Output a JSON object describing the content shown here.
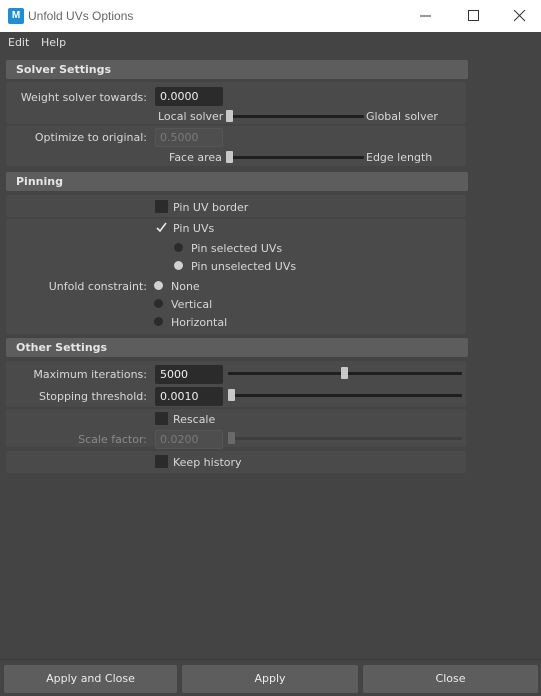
{
  "window": {
    "title": "Unfold UVs Options",
    "app_icon_letter": "M"
  },
  "menu": {
    "edit": "Edit",
    "help": "Help"
  },
  "solver": {
    "header": "Solver Settings",
    "weight_label": "Weight solver towards:",
    "weight_value": "0.0000",
    "weight_left": "Local solver",
    "weight_right": "Global solver",
    "weight_slider": 0.0,
    "optimize_label": "Optimize to original:",
    "optimize_value": "0.5000",
    "optimize_left": "Face area",
    "optimize_right": "Edge length",
    "optimize_slider": 0.0
  },
  "pinning": {
    "header": "Pinning",
    "pin_border": "Pin UV border",
    "pin_border_checked": false,
    "pin_uvs": "Pin UVs",
    "pin_uvs_checked": true,
    "pin_selected": "Pin selected UVs",
    "pin_unselected": "Pin unselected UVs",
    "pin_mode_selected": "Pin unselected UVs",
    "constraint_label": "Unfold constraint:",
    "constraint_none": "None",
    "constraint_vertical": "Vertical",
    "constraint_horizontal": "Horizontal",
    "constraint_selected": "None"
  },
  "other": {
    "header": "Other Settings",
    "max_iter_label": "Maximum iterations:",
    "max_iter_value": "5000",
    "max_iter_slider": 0.5,
    "stop_label": "Stopping threshold:",
    "stop_value": "0.0010",
    "stop_slider": 0.0,
    "rescale": "Rescale",
    "rescale_checked": false,
    "scale_label": "Scale factor:",
    "scale_value": "0.0200",
    "scale_slider": 0.0,
    "keep_history": "Keep history",
    "keep_history_checked": false
  },
  "footer": {
    "apply_close": "Apply and Close",
    "apply": "Apply",
    "close": "Close"
  },
  "colors": {
    "background": "#444444",
    "header": "#5d5d5d",
    "field": "#2b2b2b",
    "button": "#5d5d5d"
  }
}
